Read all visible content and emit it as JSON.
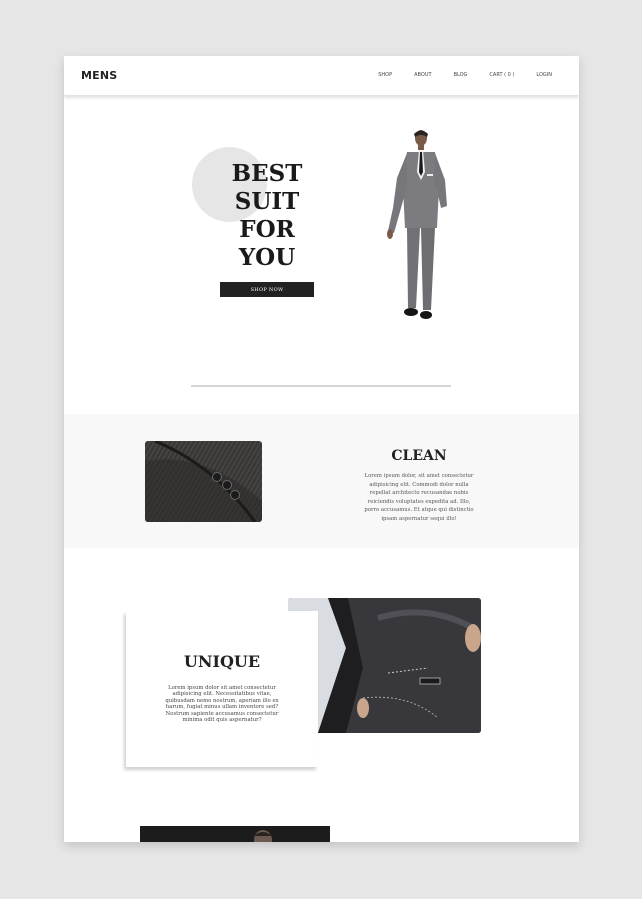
{
  "nav": {
    "logo": "MENS",
    "links": [
      "SHOP",
      "ABOUT",
      "BLOG",
      "CART ( 0 )",
      "LOGIN"
    ]
  },
  "hero": {
    "title_lines": [
      "BEST",
      "SUIT",
      "FOR",
      "YOU"
    ],
    "button": "SHOP NOW"
  },
  "clean": {
    "title": "CLEAN",
    "text": "Lorem ipsum dolor, sit amet consectetur adipisicing elit. Commodi dolor nulla repellat architecto recusandae nobis reiciendis voluptates expedita ad. Illo, porro accusamus. Et atque qui distinctio ipsam aspernatur sequi illo!"
  },
  "unique": {
    "title": "UNIQUE",
    "text": "Lorem ipsum dolor sit amet consectetur adipisicing elit. Necessitatibus vitae, quibusdam nemo nostrum, aperiam illo ex harum, fugiat minus ullam inventore sed? Nostrum sapiente accusamus consectetur minima odit quis aspernatur?"
  },
  "colors": {
    "background": "#e6e6e6",
    "dark": "#222222",
    "band": "#f8f8f8"
  }
}
